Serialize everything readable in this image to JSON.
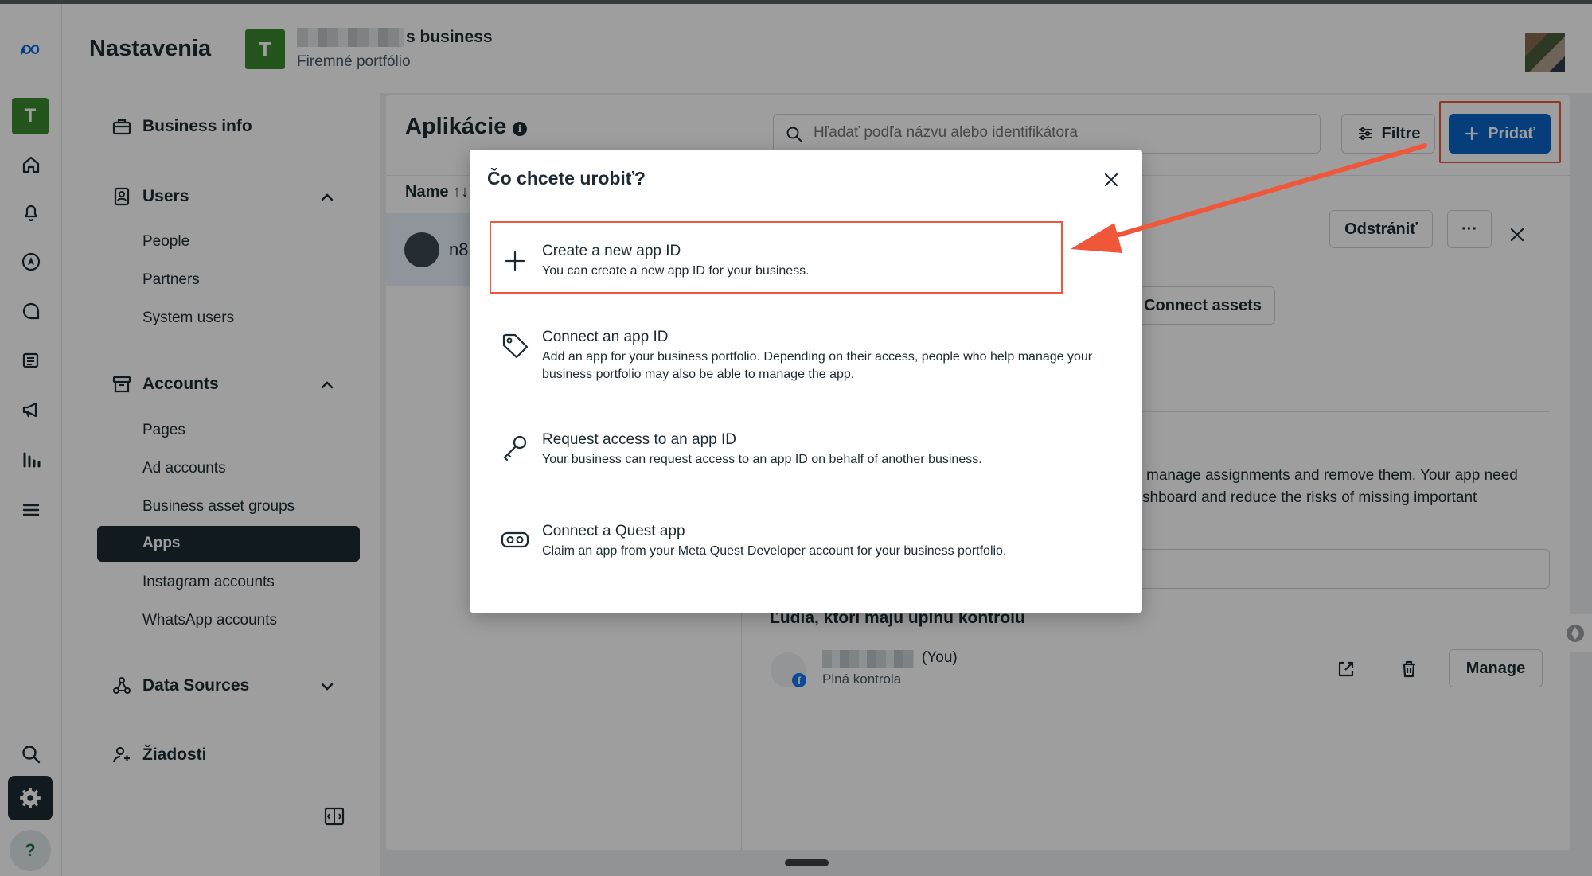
{
  "colors": {
    "accent_blue": "#0a64c8",
    "highlight_red": "#f0573a",
    "business_green": "#3a8a2e",
    "text_dark": "#1c2b33"
  },
  "rail": {
    "business_initial": "T",
    "help_label": "?",
    "icons": [
      "meta-logo-icon",
      "home-icon",
      "bell-icon",
      "compass-icon",
      "chat-icon",
      "posts-icon",
      "megaphone-icon",
      "analytics-icon",
      "menu-icon",
      "search-icon",
      "gear-icon",
      "help-icon"
    ]
  },
  "header": {
    "title": "Nastavenia",
    "business_initial": "T",
    "business_name_suffix": "s business",
    "business_subtitle": "Firemné portfólio"
  },
  "nav": {
    "business_info": "Business info",
    "users": {
      "label": "Users",
      "items": [
        "People",
        "Partners",
        "System users"
      ]
    },
    "accounts": {
      "label": "Accounts",
      "items": [
        "Pages",
        "Ad accounts",
        "Business asset groups",
        "Apps",
        "Instagram accounts",
        "WhatsApp accounts"
      ]
    },
    "data_sources": "Data Sources",
    "requests": "Žiadosti"
  },
  "main": {
    "title": "Aplikácie",
    "info_glyph": "i",
    "search_placeholder": "Hľadať podľa názvu alebo identifikátora",
    "filter_label": "Filtre",
    "add_label": "Pridať",
    "list_header": "Name ↑↓",
    "list_item_name": "n8",
    "remove_label": "Odstrániť",
    "more_label": "···",
    "connect_assets_label": "Connect assets",
    "desc_line_1": "manage assignments and remove them. Your app need",
    "desc_line_2": "shboard and reduce the risks of missing important",
    "people_heading": "Ľudia, ktorí majú úplnú kontrolu",
    "person_you": "(You)",
    "person_role": "Plná kontrola",
    "fb_badge": "f",
    "manage_label": "Manage"
  },
  "modal": {
    "title": "Čo chcete urobiť?",
    "options": [
      {
        "title": "Create a new app ID",
        "description": "You can create a new app ID for your business.",
        "icon": "plus-icon"
      },
      {
        "title": "Connect an app ID",
        "description": "Add an app for your business portfolio. Depending on their access, people who help manage your business portfolio may also be able to manage the app.",
        "icon": "tag-icon"
      },
      {
        "title": "Request access to an app ID",
        "description": "Your business can request access to an app ID on behalf of another business.",
        "icon": "key-icon"
      },
      {
        "title": "Connect a Quest app",
        "description": "Claim an app from your Meta Quest Developer account for your business portfolio.",
        "icon": "vr-headset-icon"
      }
    ]
  }
}
